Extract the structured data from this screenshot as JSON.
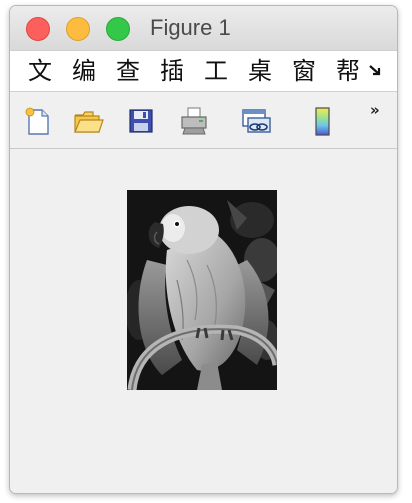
{
  "window": {
    "title": "Figure 1"
  },
  "menubar": {
    "items": [
      {
        "label": "文"
      },
      {
        "label": "编"
      },
      {
        "label": "查"
      },
      {
        "label": "插"
      },
      {
        "label": "工"
      },
      {
        "label": "桌"
      },
      {
        "label": "窗"
      },
      {
        "label": "帮"
      }
    ],
    "overflow_icon": "overflow-arrow-icon"
  },
  "toolbar": {
    "tools": [
      {
        "icon": "new-figure-icon"
      },
      {
        "icon": "open-file-icon"
      },
      {
        "icon": "save-icon"
      },
      {
        "icon": "print-icon"
      },
      {
        "icon": "link-plot-icon"
      },
      {
        "icon": "colorbar-icon"
      }
    ],
    "overflow_label": "»"
  },
  "figure": {
    "image_subject": "grayscale parrot photo",
    "colormap": "gray"
  },
  "colors": {
    "close": "#fc605c",
    "minimize": "#fdbc40",
    "maximize": "#34c84a",
    "background": "#f0f0f0"
  }
}
